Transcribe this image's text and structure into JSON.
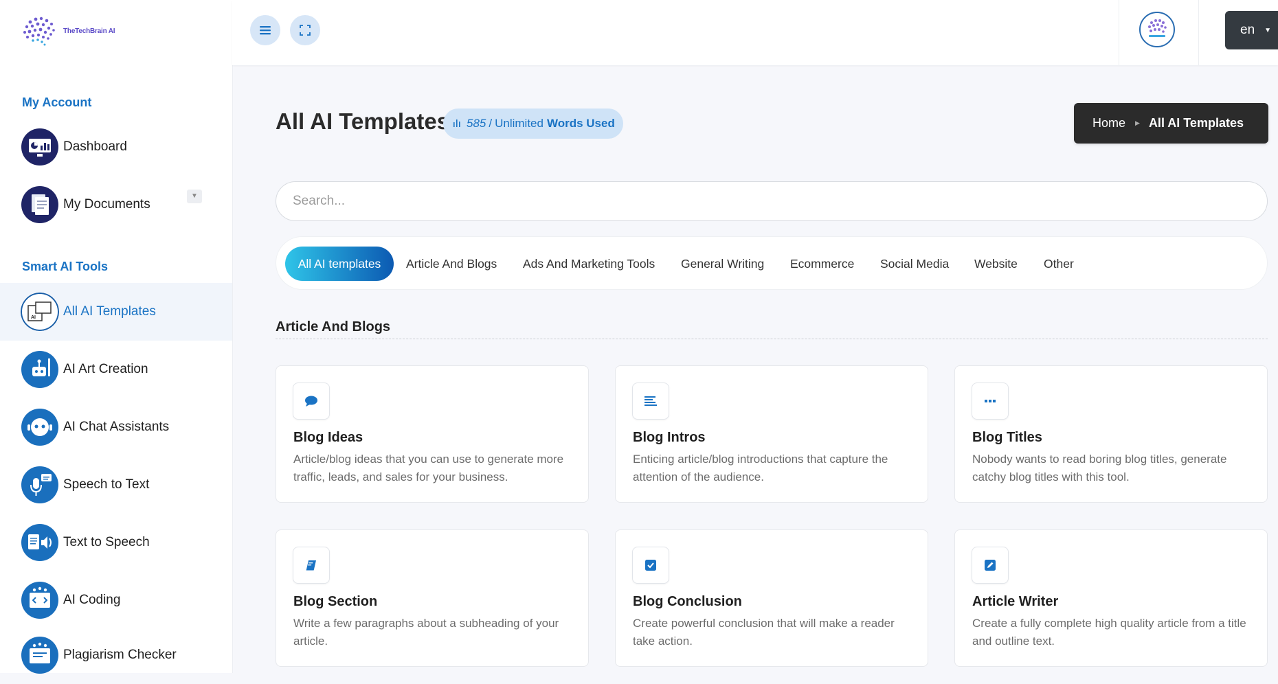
{
  "brand": {
    "name": "TheTechBrain AI"
  },
  "colors": {
    "accent": "#1a73c4",
    "gradient_start": "#2fc4e8",
    "gradient_end": "#0c5ab2",
    "dark": "#2b2b2b"
  },
  "sidebar": {
    "sections": [
      {
        "label": "My Account"
      },
      {
        "label": "Smart AI Tools"
      }
    ],
    "items": [
      {
        "label": "Dashboard",
        "icon": "dashboard-icon"
      },
      {
        "label": "My Documents",
        "icon": "documents-icon"
      },
      {
        "label": "All AI Templates",
        "icon": "ai-templates-icon",
        "active": true
      },
      {
        "label": "AI Art Creation",
        "icon": "robot-art-icon"
      },
      {
        "label": "AI Chat Assistants",
        "icon": "chat-bot-icon"
      },
      {
        "label": "Speech to Text",
        "icon": "microphone-icon"
      },
      {
        "label": "Text to Speech",
        "icon": "speaker-icon"
      },
      {
        "label": "AI Coding",
        "icon": "code-icon"
      },
      {
        "label": "Plagiarism Checker",
        "icon": "plagiarism-icon"
      }
    ]
  },
  "topbar": {
    "menu_icon": "hamburger-icon",
    "fullscreen_icon": "fullscreen-icon",
    "language": "en"
  },
  "header": {
    "title": "All AI Templates",
    "words_used": "585",
    "words_limit": "Unlimited",
    "words_label": "Words Used"
  },
  "breadcrumb": {
    "home": "Home",
    "current": "All AI Templates"
  },
  "search": {
    "placeholder": "Search...",
    "value": ""
  },
  "tabs": [
    {
      "label": "All AI templates",
      "active": true
    },
    {
      "label": "Article And Blogs"
    },
    {
      "label": "Ads And Marketing Tools"
    },
    {
      "label": "General Writing"
    },
    {
      "label": "Ecommerce"
    },
    {
      "label": "Social Media"
    },
    {
      "label": "Website"
    },
    {
      "label": "Other"
    }
  ],
  "section": {
    "title": "Article And Blogs"
  },
  "cards": [
    {
      "title": "Blog Ideas",
      "desc": "Article/blog ideas that you can use to generate more traffic, leads, and sales for your business.",
      "icon": "comment-icon"
    },
    {
      "title": "Blog Intros",
      "desc": "Enticing article/blog introductions that capture the attention of the audience.",
      "icon": "align-left-icon"
    },
    {
      "title": "Blog Titles",
      "desc": "Nobody wants to read boring blog titles, generate catchy blog titles with this tool.",
      "icon": "ellipsis-icon"
    },
    {
      "title": "Blog Section",
      "desc": "Write a few paragraphs about a subheading of your article.",
      "icon": "book-icon"
    },
    {
      "title": "Blog Conclusion",
      "desc": "Create powerful conclusion that will make a reader take action.",
      "icon": "check-square-icon"
    },
    {
      "title": "Article Writer",
      "desc": "Create a fully complete high quality article from a title and outline text.",
      "icon": "edit-icon"
    }
  ]
}
